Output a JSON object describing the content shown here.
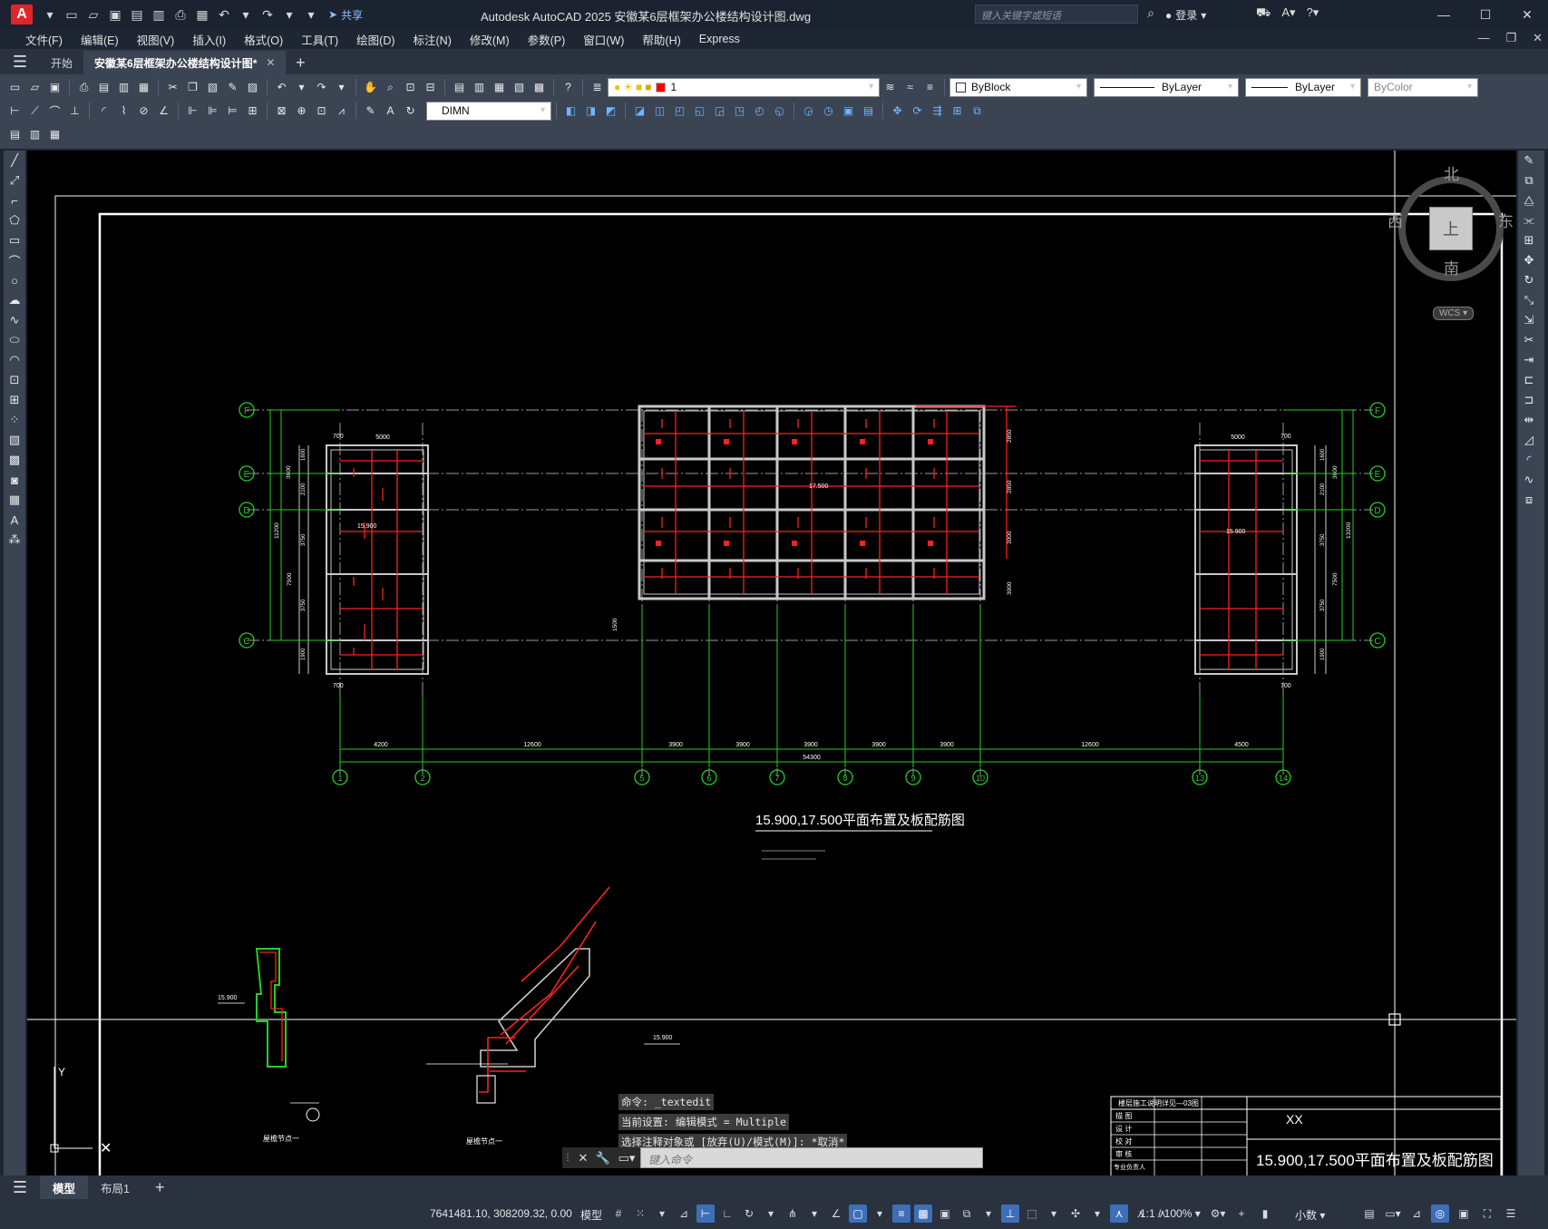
{
  "titlebar": {
    "logo": "A",
    "share": "共享",
    "title": "Autodesk AutoCAD 2025    安徽某6层框架办公楼结构设计图.dwg",
    "search_placeholder": "键入关键字或短语",
    "login": "登录"
  },
  "menu": [
    "文件(F)",
    "编辑(E)",
    "视图(V)",
    "插入(I)",
    "格式(O)",
    "工具(T)",
    "绘图(D)",
    "标注(N)",
    "修改(M)",
    "参数(P)",
    "窗口(W)",
    "帮助(H)",
    "Express"
  ],
  "tabs": {
    "start": "开始",
    "active": "安徽某6层框架办公楼结构设计图*"
  },
  "toolbar": {
    "layer_value": "1",
    "layer_color": "#ff0000",
    "color_value": "ByBlock",
    "linetype_value": "ByLayer",
    "lineweight_value": "ByLayer",
    "plotstyle_value": "ByColor",
    "dimstyle_value": "DIMN"
  },
  "viewcube": {
    "north": "北",
    "south": "南",
    "east": "东",
    "west": "西",
    "top": "上",
    "wcs": "WCS"
  },
  "drawing": {
    "main_title": "15.900,17.500平面布置及板配筋图",
    "axis_rows": [
      "F",
      "E",
      "D",
      "C"
    ],
    "axis_cols": [
      "1",
      "2",
      "5",
      "6",
      "7",
      "8",
      "9",
      "10",
      "13",
      "14"
    ],
    "col_dims": [
      "4200",
      "12600",
      "3900",
      "3900",
      "3900",
      "3900",
      "3900",
      "12600",
      "4500"
    ],
    "total_dim": "54300",
    "left_row_dims": [
      "1600",
      "2100",
      "3750",
      "3750",
      "1900"
    ],
    "left_row_dims_outer": [
      "3600",
      "7500"
    ],
    "left_total": "11200",
    "right_total": "13200",
    "width_dims": [
      "5000",
      "700"
    ],
    "mid_row_dims": [
      "2850",
      "2850",
      "3000",
      "3000"
    ],
    "offset_1500": "1500",
    "elev_left": "15.900",
    "elev_mid": "17.500",
    "elev_right": "15.900",
    "detail_elev_1": "15.900",
    "detail_elev_2": "15.900",
    "detail_label_1": "屋檐节点一",
    "detail_label_2": "屋檐节点一",
    "tb_header": "楼层施工说明详见—03图",
    "tb_rows": [
      "描 图",
      "设 计",
      "校 对",
      "审 核",
      "专业负责人"
    ],
    "tb_xx": "XX",
    "tb_title": "15.900,17.500平面布置及板配筋图"
  },
  "command": {
    "history": [
      "命令: _textedit",
      "当前设置: 编辑模式 = Multiple",
      "选择注释对象或 [放弃(U)/模式(M)]: *取消*"
    ],
    "placeholder": "键入命令"
  },
  "layout_tabs": [
    "模型",
    "布局1"
  ],
  "status": {
    "coords": "7641481.10, 308209.32, 0.00",
    "model": "模型",
    "scale": "1:1 / 100%",
    "units": "小数"
  }
}
